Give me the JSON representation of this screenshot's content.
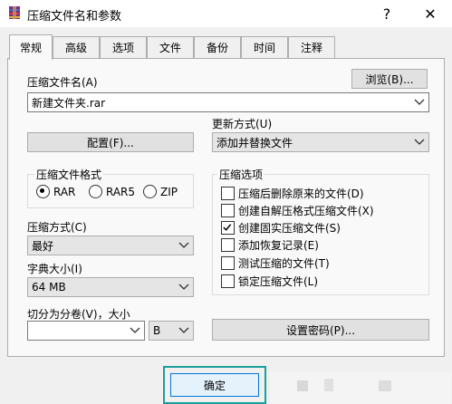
{
  "window": {
    "title": "压缩文件名和参数",
    "help": "?",
    "close": "✕"
  },
  "tabs": [
    {
      "label": "常规",
      "active": true
    },
    {
      "label": "高级"
    },
    {
      "label": "选项"
    },
    {
      "label": "文件"
    },
    {
      "label": "备份"
    },
    {
      "label": "时间"
    },
    {
      "label": "注释"
    }
  ],
  "general": {
    "archive_name_label": "压缩文件名(A)",
    "browse_button": "浏览(B)...",
    "archive_name_value": "新建文件夹.rar",
    "update_mode_label": "更新方式(U)",
    "update_mode_value": "添加并替换文件",
    "profiles_button": "配置(F)...",
    "format_group_label": "压缩文件格式",
    "formats": [
      {
        "label": "RAR",
        "selected": true
      },
      {
        "label": "RAR5",
        "selected": false
      },
      {
        "label": "ZIP",
        "selected": false
      }
    ],
    "method_label": "压缩方式(C)",
    "method_value": "最好",
    "dict_label": "字典大小(I)",
    "dict_value": "64 MB",
    "split_label": "切分为分卷(V)，大小",
    "split_value": "",
    "split_unit": "B",
    "options_group_label": "压缩选项",
    "options": [
      {
        "label": "压缩后删除原来的文件(D)",
        "checked": false
      },
      {
        "label": "创建自解压格式压缩文件(X)",
        "checked": false
      },
      {
        "label": "创建固实压缩文件(S)",
        "checked": true
      },
      {
        "label": "添加恢复记录(E)",
        "checked": false
      },
      {
        "label": "测试压缩的文件(T)",
        "checked": false
      },
      {
        "label": "锁定压缩文件(L)",
        "checked": false
      }
    ],
    "password_button": "设置密码(P)..."
  },
  "footer": {
    "ok_button": "确定"
  },
  "colors": {
    "highlight": "#1aa09c",
    "ok_border": "#0078d7"
  }
}
